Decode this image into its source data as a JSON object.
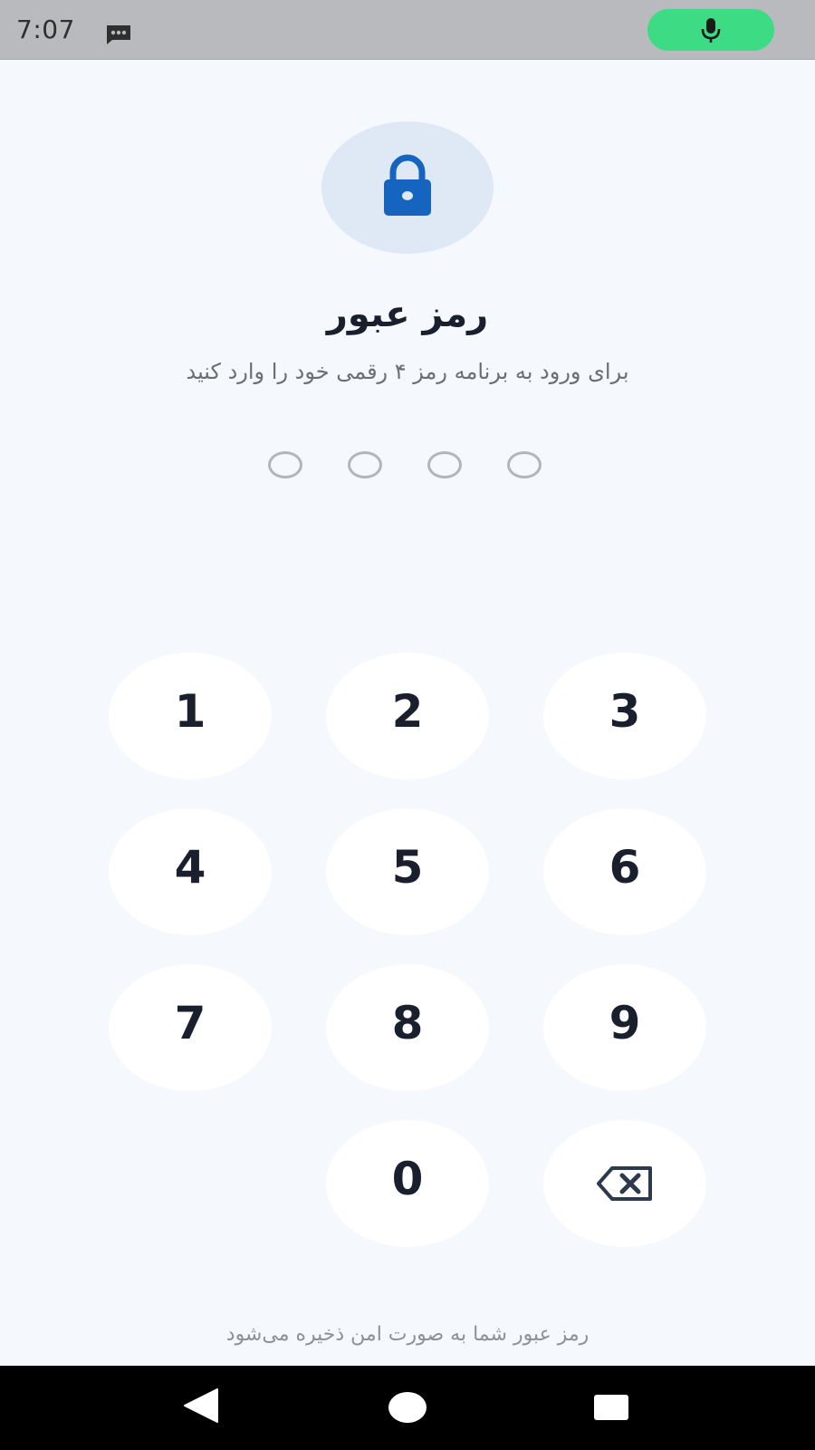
{
  "status_bar": {
    "time": "7:07",
    "message_icon": "message-icon",
    "mic_icon": "microphone-icon",
    "mic_indicator_color": "#3ddc84"
  },
  "lock_screen": {
    "lock_icon": "lock-icon",
    "title": "رمز عبور",
    "subtitle": "برای ورود به برنامه رمز ۴ رقمی خود را وارد کنید",
    "pin_length": 4,
    "pin_entered": 0,
    "accent_color": "#1565c0"
  },
  "keypad": {
    "keys": [
      "1",
      "2",
      "3",
      "4",
      "5",
      "6",
      "7",
      "8",
      "9",
      "0"
    ],
    "backspace_icon": "backspace-icon"
  },
  "footer": {
    "note": "رمز عبور شما به صورت امن ذخیره می‌شود"
  },
  "nav_bar": {
    "back_icon": "back-icon",
    "home_icon": "home-icon",
    "recents_icon": "recents-icon"
  }
}
